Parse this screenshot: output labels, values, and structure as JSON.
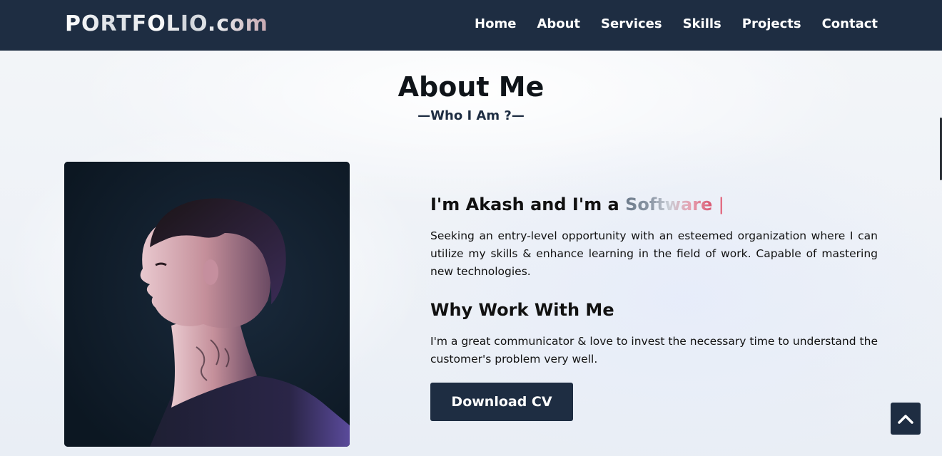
{
  "navbar": {
    "logo": "PORTFOLIO.com",
    "links": [
      "Home",
      "About",
      "Services",
      "Skills",
      "Projects",
      "Contact"
    ]
  },
  "about": {
    "title": "About Me",
    "subtitle": "—Who I Am ?—",
    "intro_prefix": "I'm Akash and I'm a",
    "typed_text": "Software",
    "cursor": "|",
    "paragraph_1": "Seeking an entry-level opportunity with an esteemed organization where I can utilize my skills & enhance learning in the field of work. Capable of mastering new technologies.",
    "why_heading": "Why Work With Me",
    "paragraph_2": "I'm a great communicator & love to invest the necessary time to understand the customer's problem very well.",
    "cv_button": "Download CV"
  },
  "icons": {
    "scroll_top": "chevron-up-icon"
  },
  "colors": {
    "nav_bg": "#1e2d42",
    "button_bg": "#1e2d42",
    "accent_pink": "#d9566f"
  }
}
